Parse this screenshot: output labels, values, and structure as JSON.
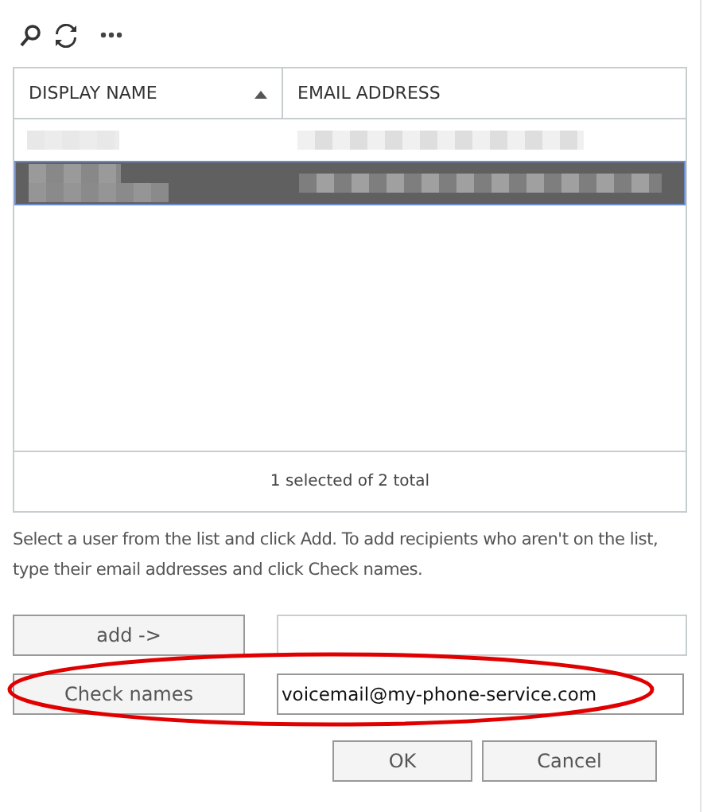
{
  "toolbar": [
    {
      "kind": "search"
    },
    {
      "kind": "refresh"
    },
    {
      "kind": "more"
    }
  ],
  "table": {
    "columns": [
      {
        "label": "DISPLAY NAME",
        "sorted": true
      },
      {
        "label": "EMAIL ADDRESS",
        "sorted": false
      }
    ],
    "rows": [
      {
        "selected": false
      },
      {
        "selected": true
      }
    ],
    "footer": "1 selected of 2 total"
  },
  "instructions": "Select a user from the list and click Add. To add recipients who aren't on the list, type their email addresses and click Check names.",
  "add_button": "add ->",
  "check_button": "Check names",
  "check_field": {
    "value": "voicemail@my-phone-service.com"
  },
  "buttons": [
    "OK",
    "Cancel"
  ],
  "annotations": [
    {
      "kind": "ellipse",
      "color": "#e00000"
    }
  ]
}
